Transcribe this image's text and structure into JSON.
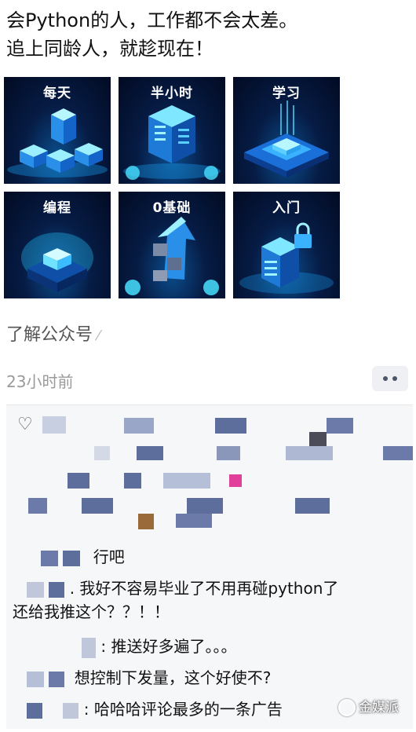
{
  "ad": {
    "line1": "会Python的人，工作都不会太差。",
    "line2": "追上同龄人，就趁现在！"
  },
  "tiles": [
    {
      "label": "每天",
      "icon": "server-cubes-icon"
    },
    {
      "label": "半小时",
      "icon": "data-tower-icon"
    },
    {
      "label": "学习",
      "icon": "chip-platform-icon"
    },
    {
      "label": "编程",
      "icon": "glowing-cube-icon"
    },
    {
      "label": "0基础",
      "icon": "growth-arrow-icon"
    },
    {
      "label": "入门",
      "icon": "secure-building-icon"
    }
  ],
  "link": {
    "text": "了解公众号",
    "icon": "link-pin-icon"
  },
  "meta": {
    "timestamp": "23小时前",
    "more_icon": "more-dots-icon"
  },
  "likes": {
    "icon": "heart-icon"
  },
  "comments": [
    {
      "text": "行吧"
    },
    {
      "text": ". 我好不容易毕业了不用再碰python了",
      "text2": "还给我推这个？？！！"
    },
    {
      "text": ": 推送好多遍了。。。"
    },
    {
      "text": "想控制下发量，这个好使不?"
    },
    {
      "text": ": 哈哈哈评论最多的一条广告"
    }
  ],
  "watermark": {
    "text": "金媒派"
  },
  "colors": {
    "tile_bg": "#061c45",
    "glow": "#27c8ff",
    "comment_bg": "#f6f7f9"
  }
}
